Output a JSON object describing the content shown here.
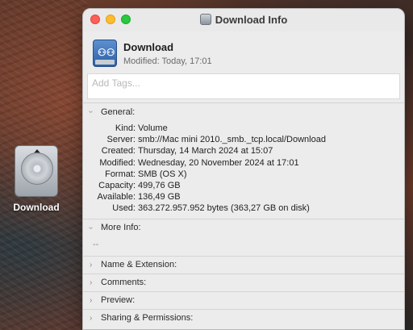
{
  "desktop": {
    "icon_label": "Download"
  },
  "window": {
    "title": "Download Info",
    "header": {
      "name": "Download",
      "modified": "Modified: Today, 17:01"
    },
    "tags_placeholder": "Add Tags..."
  },
  "general": {
    "title": "General:",
    "rows": [
      {
        "key": "Kind:",
        "value": "Volume"
      },
      {
        "key": "Server:",
        "value": "smb://Mac mini 2010._smb._tcp.local/Download"
      },
      {
        "key": "Created:",
        "value": "Thursday, 14 March 2024 at 15:07"
      },
      {
        "key": "Modified:",
        "value": "Wednesday, 20 November 2024 at 17:01"
      },
      {
        "key": "Format:",
        "value": "SMB (OS X)"
      },
      {
        "key": "Capacity:",
        "value": "499,76 GB"
      },
      {
        "key": "Available:",
        "value": "136,49 GB"
      },
      {
        "key": "Used:",
        "value": "363.272.957.952 bytes (363,27 GB on disk)"
      }
    ]
  },
  "more_info": {
    "title": "More Info:",
    "value": "--"
  },
  "sections": {
    "name_ext": "Name & Extension:",
    "comments": "Comments:",
    "preview": "Preview:",
    "sharing": "Sharing & Permissions:"
  },
  "colors": {
    "close": "#fe5f57",
    "minimize": "#febc2e",
    "maximize": "#28c840"
  }
}
